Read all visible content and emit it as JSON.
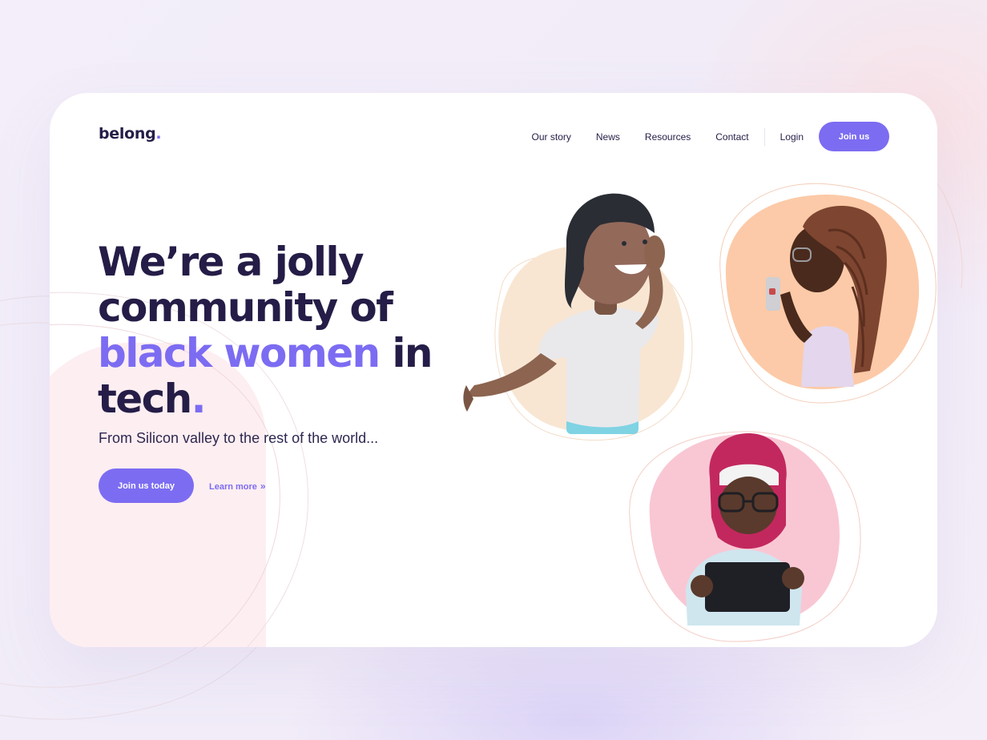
{
  "brand": {
    "name": "belong",
    "dot": ".",
    "accent_color": "#7c6cf2",
    "ink_color": "#251d47"
  },
  "nav": {
    "items": [
      {
        "label": "Our story"
      },
      {
        "label": "News"
      },
      {
        "label": "Resources"
      },
      {
        "label": "Contact"
      }
    ],
    "login_label": "Login",
    "join_label": "Join us"
  },
  "hero": {
    "line1": "We’re a jolly",
    "line2": "community of",
    "line3_accent": "black women",
    "line3_rest": " in",
    "line4": "tech",
    "line4_dot": ".",
    "subtitle": "From Silicon valley to the rest of the world...",
    "cta_label": "Join us today",
    "learn_label": "Learn more",
    "learn_icon": "double-chevron-right-icon"
  },
  "illustrations": [
    {
      "name": "woman-waving-avatar",
      "blob_color": "#f8e6d3"
    },
    {
      "name": "woman-braids-phone-avatar",
      "blob_color": "#fccaa8"
    },
    {
      "name": "woman-hijab-tablet-avatar",
      "blob_color": "#f9c7d4"
    }
  ]
}
